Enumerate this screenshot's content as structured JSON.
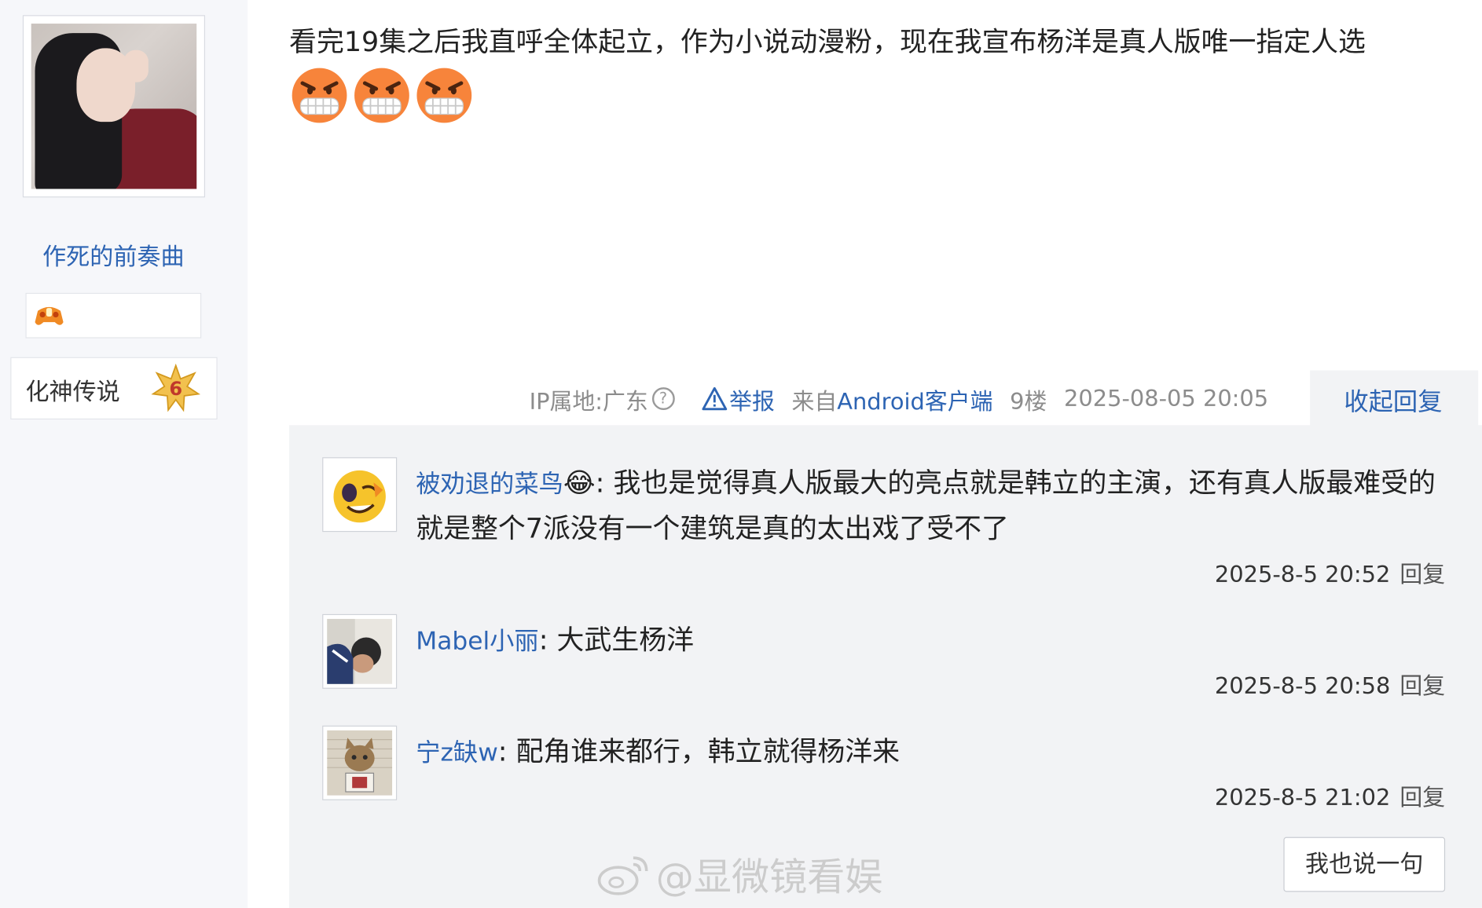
{
  "user": {
    "name": "作死的前奏曲",
    "level_title": "化神传说",
    "level_number": "6"
  },
  "post": {
    "text": "看完19集之后我直呼全体起立，作为小说动漫粉，现在我宣布杨洋是真人版唯一指定人选",
    "emoji_icons": [
      "angry-grin-icon",
      "angry-grin-icon",
      "angry-grin-icon"
    ]
  },
  "meta": {
    "ip": "IP属地:广东",
    "help": "?",
    "report": "举报",
    "from_prefix": "来自",
    "client": "Android客户端",
    "floor": "9楼",
    "datetime": "2025-08-05 20:05",
    "collapse": "收起回复"
  },
  "replies": [
    {
      "name": "被劝退的菜鸟",
      "emoji": "😂",
      "sep": ": ",
      "text": "我也是觉得真人版最大的亮点就是韩立的主演，还有真人版最难受的就是整个7派没有一个建筑是真的太出戏了受不了",
      "time": "2025-8-5 20:52",
      "reply": "回复"
    },
    {
      "name": "Mabel小丽",
      "sep": ": ",
      "text": "大武生杨洋",
      "time": "2025-8-5 20:58",
      "reply": "回复"
    },
    {
      "name": "宁z缺w",
      "sep": ": ",
      "text": "配角谁来都行，韩立就得杨洋来",
      "time": "2025-8-5 21:02",
      "reply": "回复"
    }
  ],
  "say_button": "我也说一句",
  "watermark": "@显微镜看娱",
  "colors": {
    "link": "#2d64b3",
    "reply_bg": "#f2f3f5",
    "sidebar_bg": "#f6f7fa"
  }
}
